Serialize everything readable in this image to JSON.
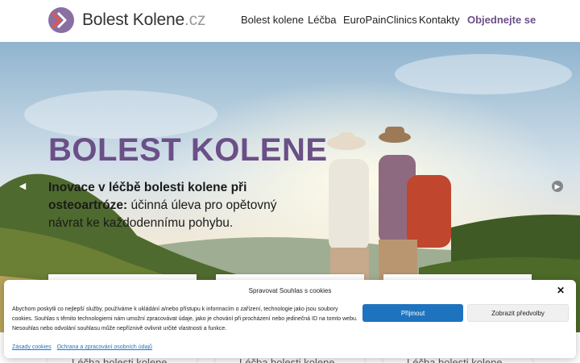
{
  "header": {
    "brand_name": "Bolest Kolene",
    "brand_tld": ".cz",
    "nav": [
      {
        "label": "Bolest kolene"
      },
      {
        "label": "Léčba"
      },
      {
        "label": "EuroPainClinics"
      },
      {
        "label": "Kontakty"
      },
      {
        "label": "Objednejte se"
      }
    ],
    "accent_color": "#6b4f87"
  },
  "hero": {
    "title": "BOLEST KOLENE",
    "subtitle_bold": "Inovace v léčbě bolesti kolene při osteoartróze:",
    "subtitle_rest": " účinná úleva pro opětovný návrat ke každodennímu pohybu.",
    "prev_icon": "chevron-left-icon",
    "next_icon": "chevron-right-icon"
  },
  "cards": [
    {
      "title": "Léčba bolesti kolene"
    },
    {
      "title": "Léčba bolesti kolene"
    },
    {
      "title": "Léčba bolesti kolene"
    }
  ],
  "cookie": {
    "title": "Spravovat Souhlas s cookies",
    "text": "Abychom poskytli co nejlepší služby, používáme k ukládání a/nebo přístupu k informacím o zařízení, technologie jako jsou soubory cookies. Souhlas s těmito technologiemi nám umožní zpracovávat údaje, jako je chování při procházení nebo jedinečná ID na tomto webu. Nesouhlas nebo odvolání souhlasu může nepříznivě ovlivnit určité vlastnosti a funkce.",
    "accept_label": "Přijmout",
    "preferences_label": "Zobrazit předvolby",
    "links": [
      {
        "label": "Zásady cookies"
      },
      {
        "label": "Ochrana a zpracování osobních údajů"
      }
    ],
    "accept_color": "#1e73be"
  }
}
